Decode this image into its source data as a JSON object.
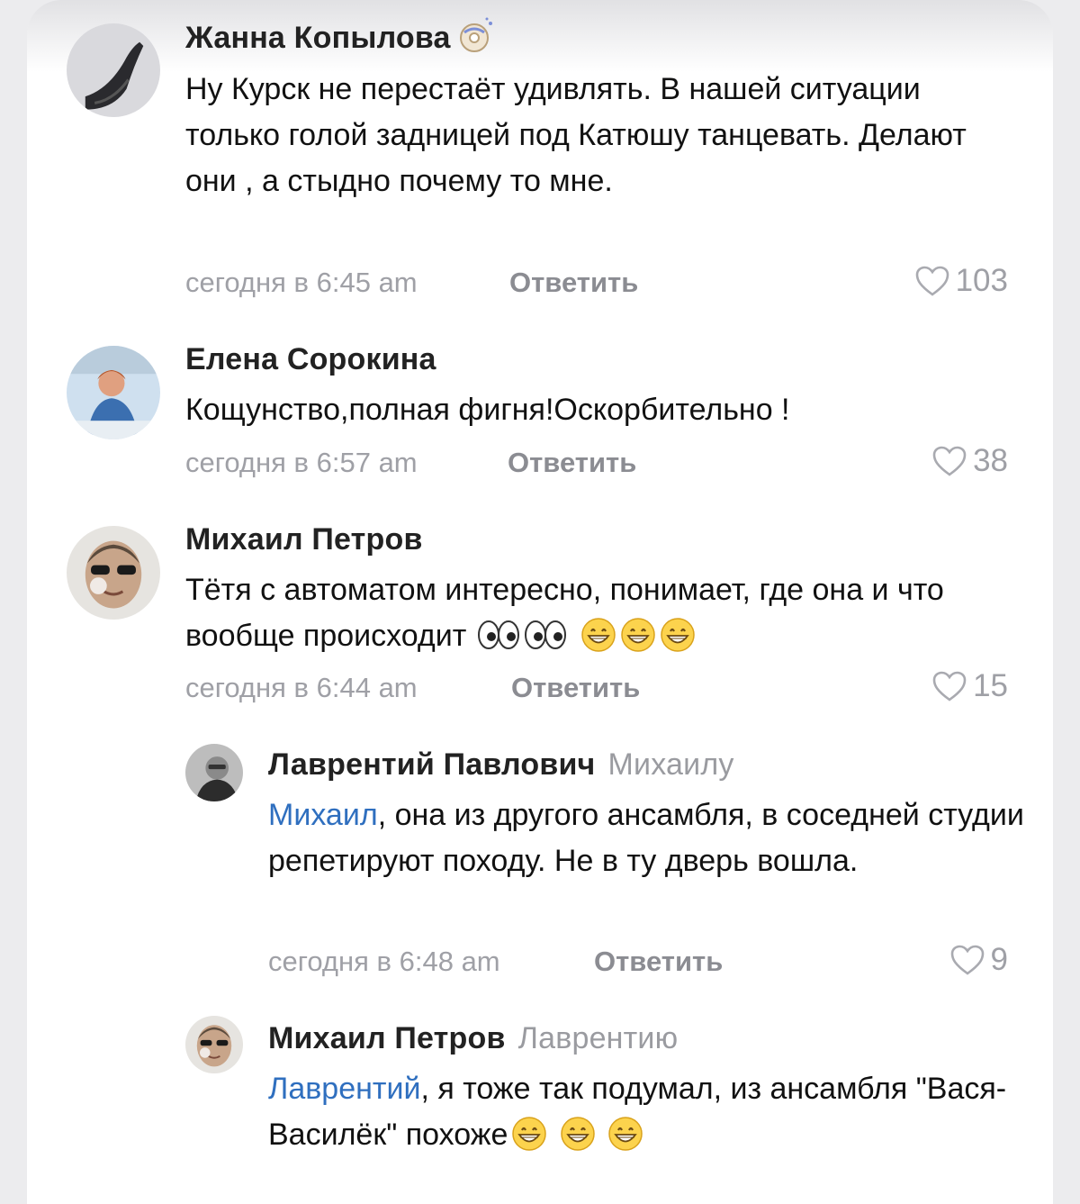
{
  "comments": [
    {
      "author": "Жанна Копылова",
      "text": "Ну Курск не перестаёт удивлять. В нашей ситуации только голой задницей под Катюшу танцевать. Делают они , а стыдно почему то мне.",
      "time": "сегодня в 6:45 am",
      "reply_label": "Ответить",
      "likes": "103"
    },
    {
      "author": "Елена Сорокина",
      "text": "Кощунство,полная фигня!Оскорбительно  !",
      "time": "сегодня в 6:57 am",
      "reply_label": "Ответить",
      "likes": "38"
    },
    {
      "author": "Михаил Петров",
      "text": "Тётя с автоматом интересно, понимает, где она и что вообще происходит",
      "time": "сегодня в 6:44 am",
      "reply_label": "Ответить",
      "likes": "15"
    },
    {
      "author": "Лаврентий Павлович",
      "reply_to": "Михаилу",
      "mention": "Михаил",
      "text": ", она из другого ансамбля, в соседней студии репетируют походу. Не в ту дверь вошла.",
      "time": "сегодня в 6:48 am",
      "reply_label": "Ответить",
      "likes": "9"
    },
    {
      "author": "Михаил Петров",
      "reply_to": "Лаврентию",
      "mention": "Лаврентий",
      "text": ", я тоже так подумал, из ансамбля \"Вася-Василёк\" похоже",
      "time": "",
      "reply_label": "",
      "likes": ""
    }
  ],
  "icons": {
    "like": "heart-outline-icon",
    "badge": "donut-badge-icon",
    "emoji_eyes": "eyes-emoji",
    "emoji_grin": "grinning-face-emoji"
  },
  "colors": {
    "mention": "#2f6fbf",
    "meta": "#9fa0a6",
    "background": "#ececee"
  }
}
